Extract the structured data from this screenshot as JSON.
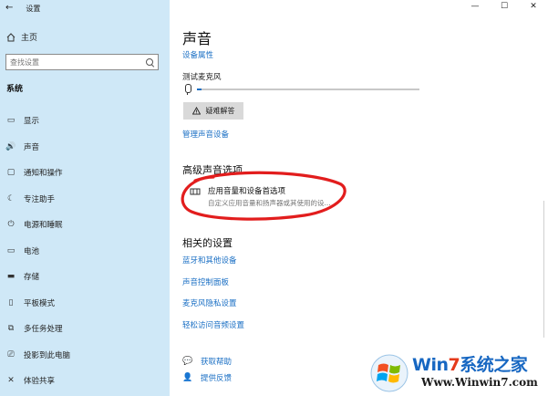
{
  "window": {
    "title": "设置",
    "back_glyph": "←",
    "controls": {
      "minimize": "—",
      "maximize": "☐",
      "close": "✕"
    }
  },
  "sidebar": {
    "home_label": "主页",
    "search_placeholder": "查找设置",
    "section_heading": "系统",
    "items": [
      {
        "label": "显示",
        "icon": "monitor-icon",
        "glyph": "▭"
      },
      {
        "label": "声音",
        "icon": "speaker-icon",
        "glyph": "🔊"
      },
      {
        "label": "通知和操作",
        "icon": "notification-icon",
        "glyph": "▢"
      },
      {
        "label": "专注助手",
        "icon": "moon-icon",
        "glyph": "☾"
      },
      {
        "label": "电源和睡眠",
        "icon": "power-icon",
        "glyph": "⏻"
      },
      {
        "label": "电池",
        "icon": "battery-icon",
        "glyph": "▭"
      },
      {
        "label": "存储",
        "icon": "storage-icon",
        "glyph": "▬"
      },
      {
        "label": "平板模式",
        "icon": "tablet-icon",
        "glyph": "▯"
      },
      {
        "label": "多任务处理",
        "icon": "multitask-icon",
        "glyph": "⧉"
      },
      {
        "label": "投影到此电脑",
        "icon": "projector-icon",
        "glyph": "⎚"
      },
      {
        "label": "体验共享",
        "icon": "share-icon",
        "glyph": "✕"
      }
    ]
  },
  "main": {
    "title": "声音",
    "device_properties_link": "设备属性",
    "mic_test_label": "测试麦克风",
    "mic_level": 0.02,
    "troubleshoot_label": "疑难解答",
    "manage_devices_link": "管理声音设备",
    "advanced_heading": "高级声音选项",
    "app_volume": {
      "title": "应用音量和设备首选项",
      "description": "自定义应用音量和扬声器或其使用的设..."
    },
    "related_heading": "相关的设置",
    "related_links": [
      "蓝牙和其他设备",
      "声音控制面板",
      "麦克风隐私设置",
      "轻松访问音频设置"
    ],
    "help_links": [
      {
        "label": "获取帮助",
        "icon": "help-chat-icon",
        "glyph": "💬"
      },
      {
        "label": "提供反馈",
        "icon": "feedback-icon",
        "glyph": "👤"
      }
    ]
  },
  "watermark": {
    "brand_prefix": "Win",
    "brand_seven": "7",
    "brand_suffix": "系统之家",
    "url": "Www.Winwin7.com"
  },
  "colors": {
    "sidebar_bg": "#cfe8f7",
    "link": "#1a6fc4",
    "annotation_red": "#e21d1d"
  }
}
